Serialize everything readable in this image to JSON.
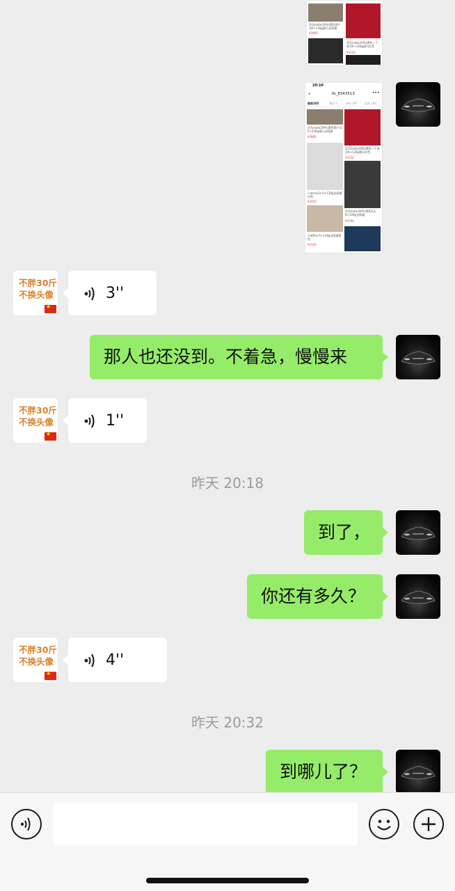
{
  "colors": {
    "outgoing_bubble": "#95ec69",
    "incoming_bubble": "#ffffff",
    "background": "#ededed",
    "avatar_text": "#d9822b"
  },
  "contact_avatar": {
    "line1": "不胖30斤",
    "line2": "不换头像"
  },
  "timestamps": [
    "昨天 20:18",
    "昨天 20:32"
  ],
  "messages": {
    "m1_text": "那人也还没到。不着急，慢慢来",
    "m2_text": "到了，",
    "m3_text": "你还有多久？",
    "m4_text": "到哪儿了？",
    "voice1": "3''",
    "voice2": "1''",
    "voice3": "4''"
  },
  "screenshot": {
    "status_time": "20:10",
    "title": "tb_8343513",
    "tabs": [
      "他的185",
      "粉丝 0",
      "评价 187",
      "足迹 283"
    ],
    "items": [
      {
        "caption": "华为mate20Pro黑色两个月6+128g国行全网通",
        "price": "¥2880"
      },
      {
        "caption": "华为mate20Pro黑色一个多月6+128g国行红色",
        "price": "¥3150"
      },
      {
        "caption": "小米mix2s 6+128g全网通白色",
        "price": "¥2050"
      },
      {
        "caption": "华为mate30Pro黑色5天8+128g全网通",
        "price": "¥4799"
      },
      {
        "caption": "小米9se 6+128g全网通黑色",
        "price": "¥1550"
      }
    ]
  },
  "bottom_bar": {
    "voice_icon": "voice-wave-icon",
    "emoji_icon": "smiley-icon",
    "plus_icon": "plus-icon"
  }
}
